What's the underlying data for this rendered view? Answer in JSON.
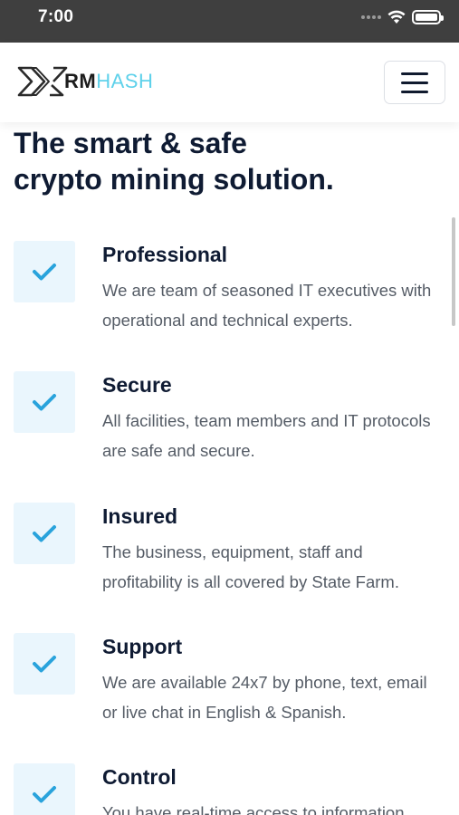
{
  "status_bar": {
    "time": "7:00"
  },
  "nav": {
    "logo_rm": "RM",
    "logo_hash": "HASH",
    "logo_accent_color": "#5ed1ea"
  },
  "hero": {
    "headline_pre": "The ",
    "headline_highlight": "smart & safe",
    "headline_line2": "crypto mining solution."
  },
  "features": [
    {
      "title": "Professional",
      "description": "We are team of seasoned IT executives with operational and technical experts."
    },
    {
      "title": "Secure",
      "description": "All facilities, team members and IT protocols are safe and secure."
    },
    {
      "title": "Insured",
      "description": "The business, equipment, staff and profitability is all covered by State Farm."
    },
    {
      "title": "Support",
      "description": "We are available 24x7 by phone, text, email or live chat in English & Spanish."
    },
    {
      "title": "Control",
      "description": "You have real-time access to information"
    }
  ],
  "colors": {
    "check": "#29a3dc",
    "check_bg": "#eaf6fd",
    "heading": "#0f1b33",
    "body_text": "#555c66"
  },
  "icons": {
    "feature_icon": "checkmark-icon",
    "menu_icon": "hamburger-menu-icon"
  }
}
